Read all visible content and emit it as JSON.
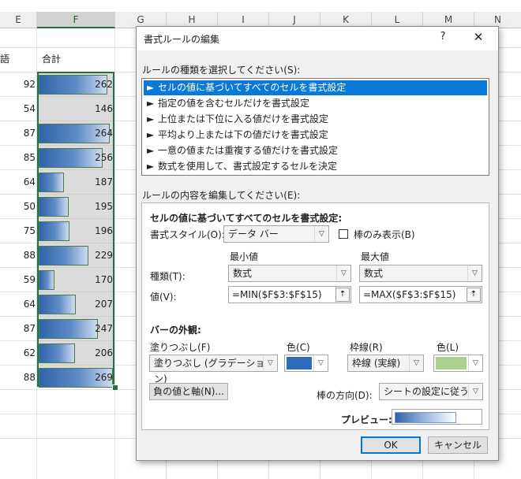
{
  "sheet": {
    "columns": [
      "E",
      "F",
      "G",
      "H",
      "I",
      "J",
      "K",
      "L",
      "M",
      "N"
    ],
    "e_header_text": "語",
    "f_header_text": "合計",
    "rows": [
      {
        "e": "92",
        "f": "262",
        "bar_fill": 0.92
      },
      {
        "e": "54",
        "f": "146",
        "bar_fill": 0.0
      },
      {
        "e": "87",
        "f": "264",
        "bar_fill": 0.96
      },
      {
        "e": "85",
        "f": "256",
        "bar_fill": 0.86
      },
      {
        "e": "64",
        "f": "187",
        "bar_fill": 0.33
      },
      {
        "e": "50",
        "f": "195",
        "bar_fill": 0.39
      },
      {
        "e": "75",
        "f": "196",
        "bar_fill": 0.4
      },
      {
        "e": "88",
        "f": "229",
        "bar_fill": 0.66
      },
      {
        "e": "59",
        "f": "170",
        "bar_fill": 0.2
      },
      {
        "e": "64",
        "f": "207",
        "bar_fill": 0.49
      },
      {
        "e": "87",
        "f": "247",
        "bar_fill": 0.79
      },
      {
        "e": "62",
        "f": "206",
        "bar_fill": 0.48
      },
      {
        "e": "88",
        "f": "269",
        "bar_fill": 1.0
      }
    ]
  },
  "dialog": {
    "title": "書式ルールの編集",
    "help": "?",
    "close": "✕",
    "select_rule_type_label": "ルールの種類を選択してください(S):",
    "rule_types": [
      "セルの値に基づいてすべてのセルを書式設定",
      "指定の値を含むセルだけを書式設定",
      "上位または下位に入る値だけを書式設定",
      "平均より上または下の値だけを書式設定",
      "一意の値または重複する値だけを書式設定",
      "数式を使用して、書式設定するセルを決定"
    ],
    "rule_arrow": "►",
    "edit_rule_label": "ルールの内容を編集してください(E):",
    "section_title": "セルの値に基づいてすべてのセルを書式設定:",
    "format_style_label": "書式スタイル(O):",
    "format_style_value": "データ バー",
    "show_bar_only_label": "棒のみ表示(B)",
    "min_header": "最小値",
    "max_header": "最大値",
    "type_label": "種類(T):",
    "min_type": "数式",
    "max_type": "数式",
    "value_label": "値(V):",
    "min_value": "=MIN($F$3:$F$15)",
    "max_value": "=MAX($F$3:$F$15)",
    "ref_icon": "⇡",
    "bar_appearance_label": "バーの外観:",
    "fill_label": "塗りつぶし(F)",
    "fill_value": "塗りつぶし (グラデーション)",
    "fill_color_label": "色(C)",
    "fill_color": "#2e6bb8",
    "border_label": "枠線(R)",
    "border_value": "枠線 (実線)",
    "border_color_label": "色(L)",
    "border_color": "#a9d08e",
    "negative_axis_button": "負の値と軸(N)...",
    "bar_direction_label": "棒の方向(D):",
    "bar_direction_value": "シートの設定に従う",
    "preview_label": "プレビュー:",
    "ok": "OK",
    "cancel": "キャンセル",
    "dropdown_arrow": "▽"
  }
}
